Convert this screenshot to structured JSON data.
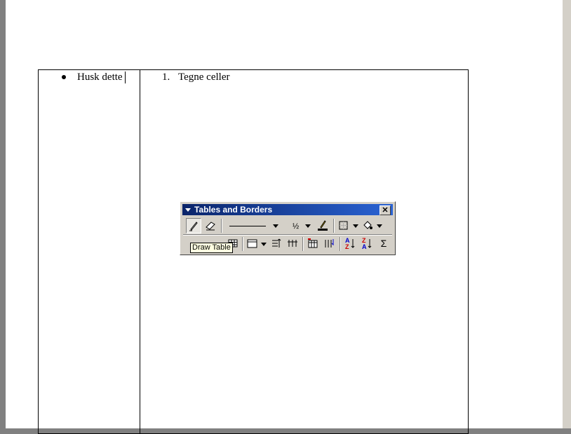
{
  "document": {
    "bullet_item": "Husk dette",
    "numbered_marker": "1.",
    "numbered_item": "Tegne celler"
  },
  "toolbar": {
    "title": "Tables and Borders",
    "close_glyph": "✕",
    "line_weight": "½",
    "sort_ascending": "A↓Z",
    "sort_descending": "Z↓A",
    "autosum": "Σ",
    "tooltip": "Draw Table",
    "icons": [
      "draw-table-icon",
      "eraser-icon",
      "line-style-icon",
      "line-weight-icon",
      "border-color-icon",
      "outside-border-icon",
      "shading-color-icon",
      "insert-table-icon",
      "merge-cells-icon",
      "split-cells-icon",
      "align-icon",
      "distribute-rows-icon",
      "distribute-columns-icon",
      "table-autoformat-icon",
      "change-text-direction-icon",
      "sort-ascending-icon",
      "sort-descending-icon",
      "autosum-icon"
    ]
  },
  "colors": {
    "title_bar": "#0a246a",
    "toolbar_face": "#d4d0c8",
    "tooltip_bg": "#ffffe1"
  }
}
